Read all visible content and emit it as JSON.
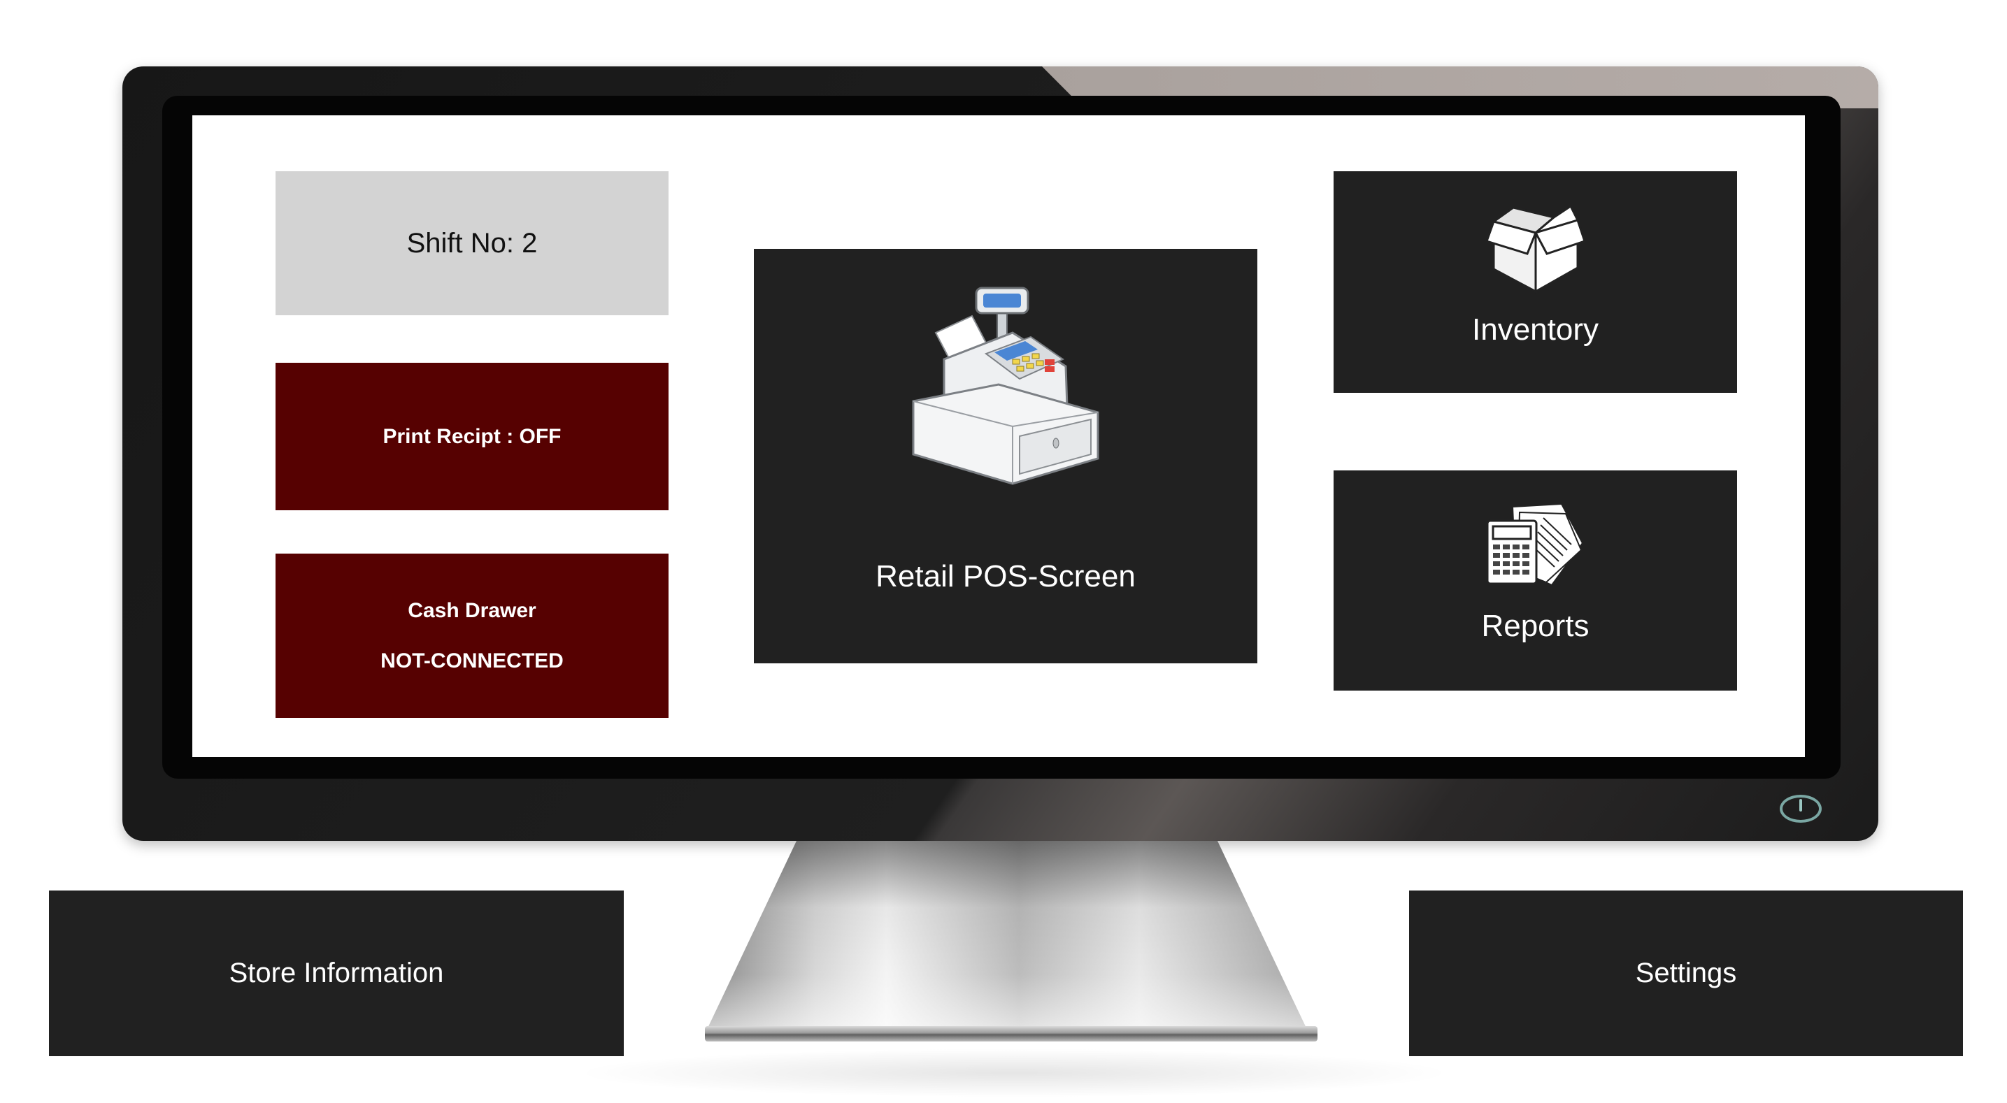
{
  "status": {
    "shift_label": "Shift No: 2",
    "print_receipt_label": "Print Recipt : OFF",
    "cash_drawer_title": "Cash Drawer",
    "cash_drawer_status": "NOT-CONNECTED"
  },
  "tiles": {
    "retail_pos": {
      "label": "Retail POS-Screen",
      "icon": "cash-register-icon"
    },
    "inventory": {
      "label": "Inventory",
      "icon": "box-icon"
    },
    "reports": {
      "label": "Reports",
      "icon": "calculator-reports-icon"
    }
  },
  "footer": {
    "store_information_label": "Store Information",
    "settings_label": "Settings"
  },
  "colors": {
    "tile_dark": "#212121",
    "tile_alert": "#560101",
    "tile_neutral": "#d3d3d3",
    "power_led": "#7aa7a3"
  }
}
